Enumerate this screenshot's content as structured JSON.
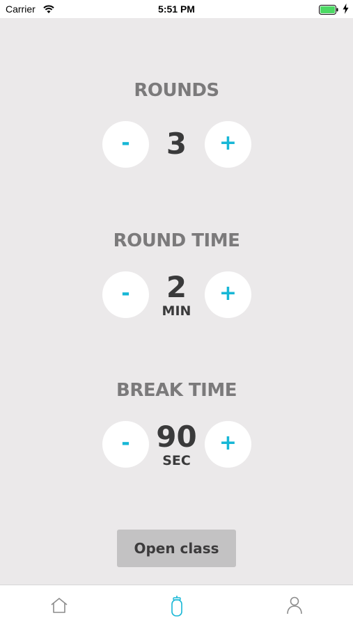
{
  "status_bar": {
    "carrier": "Carrier",
    "time": "5:51 PM"
  },
  "stepper": {
    "rounds": {
      "label": "ROUNDS",
      "value": "3",
      "unit": "",
      "minus_label": "-",
      "plus_label": "+"
    },
    "round_time": {
      "label": "ROUND TIME",
      "value": "2",
      "unit": "MIN",
      "minus_label": "-",
      "plus_label": "+"
    },
    "break_time": {
      "label": "BREAK TIME",
      "value": "90",
      "unit": "SEC",
      "minus_label": "-",
      "plus_label": "+"
    }
  },
  "open_class": {
    "label": "Open class"
  },
  "tab_bar": {
    "tabs": [
      {
        "icon": "home-icon",
        "active": false
      },
      {
        "icon": "punching-bag-icon",
        "active": true
      },
      {
        "icon": "profile-icon",
        "active": false
      }
    ]
  },
  "colors": {
    "background": "#ebe9ea",
    "accent": "#17b7d6",
    "label_gray": "#7b7a7b",
    "value_dark": "#3a3a3b",
    "button_gray": "#c3c2c3"
  }
}
